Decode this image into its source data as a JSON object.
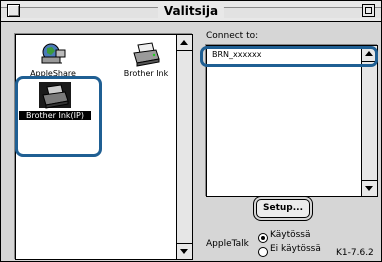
{
  "window": {
    "title": "Valitsija"
  },
  "left_panel": {
    "items": [
      {
        "label": "AppleShare",
        "icon": "appleshare-icon",
        "selected": false
      },
      {
        "label": "Brother Ink",
        "icon": "printer-icon",
        "selected": false
      },
      {
        "label": "Brother Ink(IP)",
        "icon": "printer-ip-icon",
        "selected": true
      }
    ]
  },
  "right_panel": {
    "connect_label": "Connect to:",
    "list": [
      "BRN_xxxxxx"
    ]
  },
  "setup_label": "Setup...",
  "appletalk": {
    "label": "AppleTalk",
    "options": [
      {
        "label": "Käytössä",
        "selected": true
      },
      {
        "label": "Ei käytössä",
        "selected": false
      }
    ]
  },
  "version": "K1-7.6.2",
  "colors": {
    "highlight_outline": "#1f5f93"
  }
}
